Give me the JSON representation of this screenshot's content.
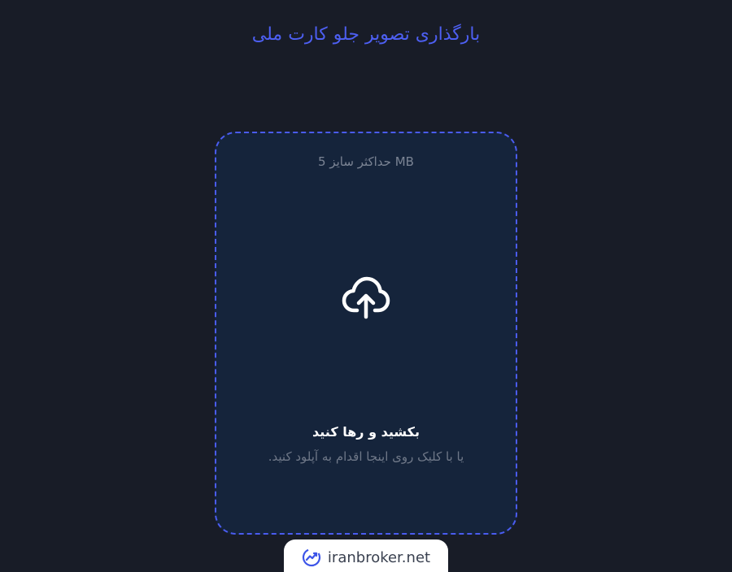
{
  "page": {
    "title": "بارگذاری تصویر جلو کارت ملی"
  },
  "dropzone": {
    "max_size": "حداکثر سایز 5 MB",
    "icon": "cloud-upload-icon",
    "drag_title": "بکشید و رها کنید",
    "drag_subtitle": "یا با کلیک روی اینجا اقدام به آپلود کنید."
  },
  "brand": {
    "logo_icon": "trend-chart-icon",
    "text": "iranbroker.net"
  },
  "colors": {
    "background": "#181c27",
    "accent": "#4d5ff2",
    "dropzone_bg": "#15243b"
  }
}
